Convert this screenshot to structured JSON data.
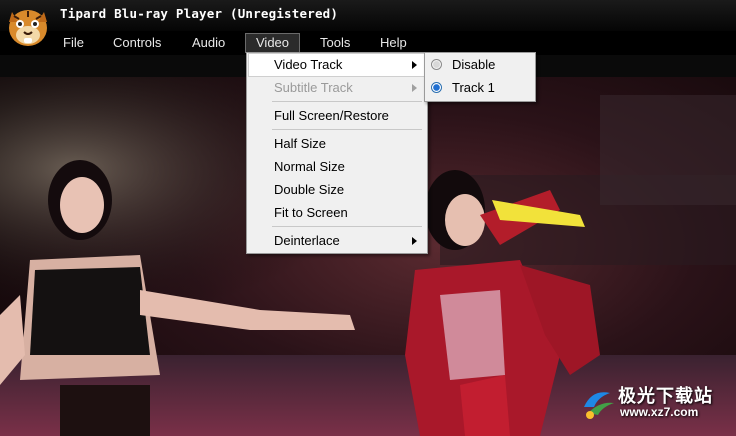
{
  "window": {
    "title": "Tipard Blu-ray Player (Unregistered)"
  },
  "menubar": {
    "items": [
      {
        "label": "File"
      },
      {
        "label": "Controls"
      },
      {
        "label": "Audio"
      },
      {
        "label": "Video"
      },
      {
        "label": "Tools"
      },
      {
        "label": "Help"
      }
    ],
    "active": "Video"
  },
  "video_menu": {
    "items": [
      {
        "label": "Video Track",
        "submenu": true,
        "enabled": true,
        "highlighted": true
      },
      {
        "label": "Subtitle Track",
        "submenu": true,
        "enabled": false
      },
      {
        "label": "Full Screen/Restore"
      },
      {
        "label": "Half Size"
      },
      {
        "label": "Normal Size"
      },
      {
        "label": "Double Size"
      },
      {
        "label": "Fit to Screen"
      },
      {
        "label": "Deinterlace",
        "submenu": true
      }
    ]
  },
  "video_track_submenu": {
    "options": [
      {
        "label": "Disable",
        "selected": false
      },
      {
        "label": "Track 1",
        "selected": true
      }
    ]
  },
  "watermark": {
    "text": "极光下载站",
    "url": "www.xz7.com"
  },
  "colors": {
    "menu_bg": "#f0f0f0",
    "titlebar_bg": "#0a0a0a",
    "radio_selected": "#1f6fd1"
  }
}
